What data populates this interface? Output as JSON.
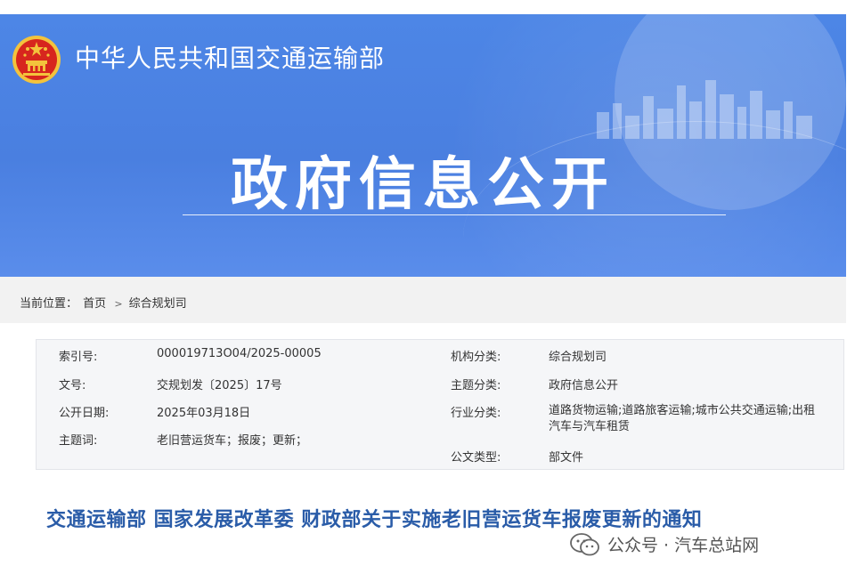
{
  "header": {
    "ministry_name": "中华人民共和国交通运输部",
    "banner_title": "政府信息公开"
  },
  "breadcrumb": {
    "prefix": "当前位置：",
    "items": [
      "首页",
      "综合规划司"
    ],
    "separator": ">"
  },
  "metadata": {
    "left": [
      {
        "label": "索引号:",
        "value": "000019713O04/2025-00005"
      },
      {
        "label": "文号:",
        "value": "交规划发〔2025〕17号"
      },
      {
        "label": "公开日期:",
        "value": "2025年03月18日"
      },
      {
        "label": "主题词:",
        "value": "老旧营运货车；报废；更新；"
      }
    ],
    "right": [
      {
        "label": "机构分类:",
        "value": "综合规划司"
      },
      {
        "label": "主题分类:",
        "value": "政府信息公开"
      },
      {
        "label": "行业分类:",
        "value": "道路货物运输;道路旅客运输;城市公共交通运输;出租汽车与汽车租赁"
      },
      {
        "label": "公文类型:",
        "value": "部文件"
      }
    ]
  },
  "document": {
    "title": "交通运输部 国家发展改革委 财政部关于实施老旧营运货车报废更新的通知"
  },
  "watermark": {
    "text": "公众号 · 汽车总站网",
    "icon": "wechat-icon"
  },
  "colors": {
    "banner": "#4a7fe0",
    "title": "#2a5ca8",
    "emblem_red": "#d7261e",
    "emblem_gold": "#f3c33c"
  }
}
